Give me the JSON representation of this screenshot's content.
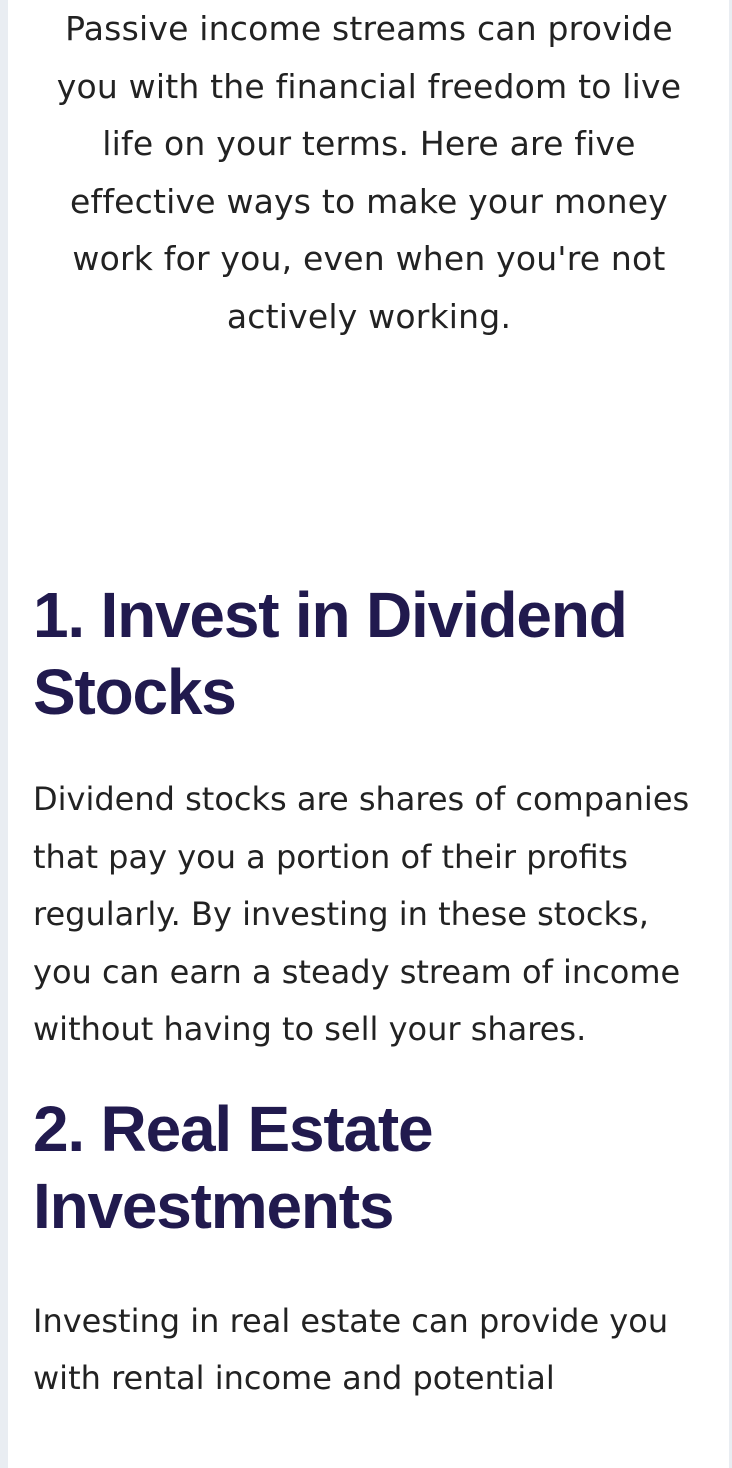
{
  "intro": {
    "text": "Passive income streams can provide you with the financial freedom to live life on your terms. Here are five effective ways to make your money work for you, even when you're not actively working."
  },
  "sections": [
    {
      "heading": "1. Invest in Dividend Stocks",
      "body": "Dividend stocks are shares of companies that pay you a portion of their profits regularly. By investing in these stocks, you can earn a steady stream of income without having to sell your shares."
    },
    {
      "heading": "2. Real Estate Investments",
      "body": "Investing in real estate can provide you with rental income and potential"
    }
  ],
  "colors": {
    "heading": "#211a4e",
    "body_text": "#222222",
    "page_background": "#ffffff",
    "side_background": "#e9edf2"
  }
}
